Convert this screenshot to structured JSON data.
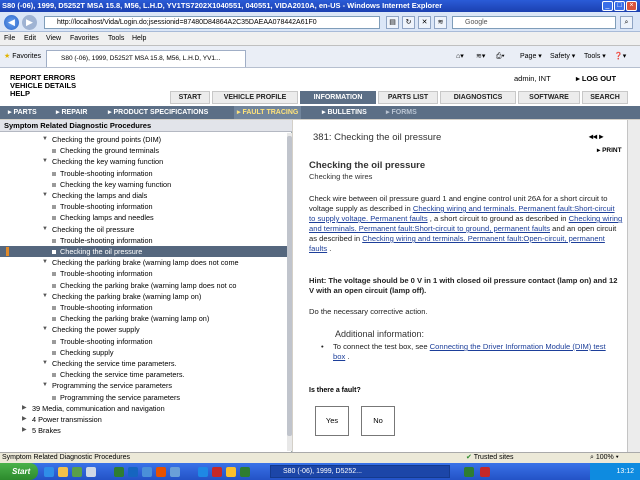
{
  "window": {
    "title": "S80 (-06), 1999, D5252T MSA 15.8, M56, L.H.D, YV1TS7202X1040551, 040551, VIDA2010A, en-US - Windows Internet Explorer"
  },
  "browser": {
    "address": "http://localhost/Vida/Login.do;jsessionid=87480D84864A2C35DAEAA078442A61F0",
    "search_placeholder": "Google",
    "menu": [
      "File",
      "Edit",
      "View",
      "Favorites",
      "Tools",
      "Help"
    ],
    "favorites_label": "Favorites",
    "tab_title": "S80 (-06), 1999, D5252T MSA 15.8, M56, L.H.D, YV1...",
    "toolbar": {
      "page": "Page",
      "safety": "Safety",
      "tools": "Tools"
    }
  },
  "app": {
    "header_links": [
      "REPORT ERRORS",
      "VEHICLE DETAILS",
      "HELP"
    ],
    "user": "admin, INT",
    "logout": "LOG OUT",
    "tabs": [
      "START",
      "VEHICLE PROFILE",
      "INFORMATION",
      "PARTS LIST",
      "DIAGNOSTICS",
      "SOFTWARE",
      "SEARCH"
    ],
    "active_tab": "INFORMATION",
    "nav": [
      "PARTS",
      "REPAIR",
      "PRODUCT SPECIFICATIONS",
      "FAULT TRACING",
      "BULLETINS",
      "FORMS"
    ]
  },
  "tree": {
    "title": "Symptom Related Diagnostic Procedures",
    "items": [
      {
        "label": "Checking the ground points (DIM)",
        "kind": "folder"
      },
      {
        "label": "Checking the ground terminals",
        "kind": "leaf"
      },
      {
        "label": "Checking the key warning function",
        "kind": "folder"
      },
      {
        "label": "Trouble-shooting information",
        "kind": "leaf"
      },
      {
        "label": "Checking the key warning function",
        "kind": "leaf"
      },
      {
        "label": "Checking the lamps and dials",
        "kind": "folder"
      },
      {
        "label": "Trouble-shooting information",
        "kind": "leaf"
      },
      {
        "label": "Checking lamps and needles",
        "kind": "leaf"
      },
      {
        "label": "Checking the oil pressure",
        "kind": "folder"
      },
      {
        "label": "Trouble-shooting information",
        "kind": "leaf"
      },
      {
        "label": "Checking the oil pressure",
        "kind": "leaf",
        "selected": true
      },
      {
        "label": "Checking the parking brake (warning lamp does not come",
        "kind": "folder"
      },
      {
        "label": "Trouble-shooting information",
        "kind": "leaf"
      },
      {
        "label": "Checking the parking brake (warning lamp does not co",
        "kind": "leaf"
      },
      {
        "label": "Checking the parking brake (warning lamp on)",
        "kind": "folder"
      },
      {
        "label": "Trouble-shooting information",
        "kind": "leaf"
      },
      {
        "label": "Checking the parking brake (warning lamp on)",
        "kind": "leaf"
      },
      {
        "label": "Checking the power supply",
        "kind": "folder"
      },
      {
        "label": "Trouble-shooting information",
        "kind": "leaf"
      },
      {
        "label": "Checking supply",
        "kind": "leaf"
      },
      {
        "label": "Checking the service time parameters.",
        "kind": "folder"
      },
      {
        "label": "Checking the service time parameters.",
        "kind": "leaf"
      },
      {
        "label": "Programming the service parameters",
        "kind": "folder"
      },
      {
        "label": "Programming the service parameters",
        "kind": "leaf"
      },
      {
        "label": "39 Media, communication and navigation",
        "kind": "top"
      },
      {
        "label": "4 Power transmission",
        "kind": "top"
      },
      {
        "label": "5 Brakes",
        "kind": "top"
      }
    ]
  },
  "doc": {
    "title": "381: Checking the oil pressure",
    "print": "PRINT",
    "heading": "Checking the oil pressure",
    "subheading": "Checking the wires",
    "p1": [
      {
        "t": "Check wire between oil pressure guard 1 and engine control unit 26A for a short circuit to voltage supply as described in "
      },
      {
        "t": "Checking wiring and terminals. Permanent fault:Short-circuit to supply voltage. Permanent faults",
        "link": true
      },
      {
        "t": " , a short circuit to ground as described in "
      },
      {
        "t": "Checking wiring and terminals. Permanent fault:Short-circuit to ground, permanent faults",
        "link": true
      },
      {
        "t": " and an open circuit as described in "
      },
      {
        "t": "Checking wiring and terminals. Permanent fault:Open-circuit, permanent faults",
        "link": true
      },
      {
        "t": " ."
      }
    ],
    "hint": "Hint: The voltage should be 0 V in 1 with closed oil pressure contact (lamp on) and 12 V with an open circuit (lamp off).",
    "corrective": "Do the necessary corrective action.",
    "additional_title": "Additional information:",
    "additional_prefix": "To connect the test box, see ",
    "additional_link": "Connecting the Driver Information Module (DIM) test box",
    "additional_suffix": " .",
    "question": "Is there a fault?",
    "yes": "Yes",
    "no": "No"
  },
  "status": {
    "text": "Symptom Related Diagnostic Procedures",
    "trusted": "Trusted sites",
    "zoom": "100%"
  },
  "taskbar": {
    "start": "Start",
    "item": "S80 (-06), 1999, D5252...",
    "clock": "13:12"
  }
}
